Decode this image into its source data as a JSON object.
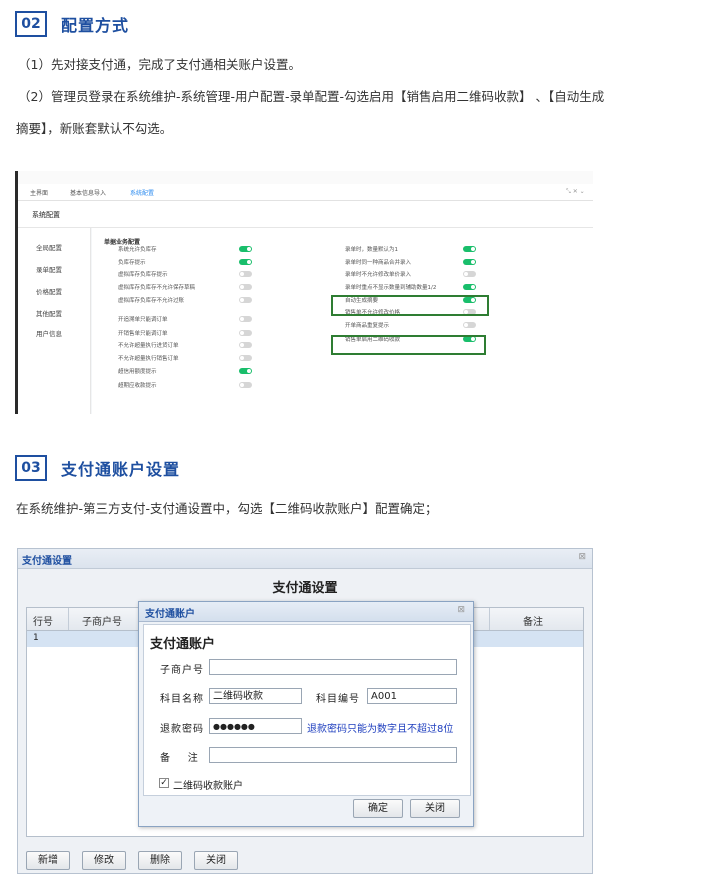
{
  "section2": {
    "number": "02",
    "title": "配置方式",
    "para1": "（1）先对接支付通，完成了支付通相关账户设置。",
    "para2a": "（2）管理员登录在系统维护-系统管理-用户配置-录单配置-勾选启用【销售启用二维码收款】 、【自动生成",
    "para2b": "摘要】，新账套默认不勾选。"
  },
  "shot1": {
    "tabs": [
      "主界面",
      "基本信息导入",
      "系统配置"
    ],
    "page_title": "系统配置",
    "sidebar": [
      "全局配置",
      "录单配置",
      "价格配置",
      "其他配置",
      "用户信息"
    ],
    "group_title": "单据业务配置",
    "left_options": [
      {
        "label": "系统允许负库存",
        "on": true
      },
      {
        "label": "负库存提示",
        "on": true
      },
      {
        "label": "虚拟库存负库存提示",
        "on": false
      },
      {
        "label": "虚拟库存负库存不允许保存草稿",
        "on": false
      },
      {
        "label": "虚拟库存负库存不允许过账",
        "on": false
      },
      {
        "label": "开追溯单只能调订单",
        "on": false
      },
      {
        "label": "开销售单只能调订单",
        "on": false
      },
      {
        "label": "不允许超量执行进货订单",
        "on": false
      },
      {
        "label": "不允许超量执行销售订单",
        "on": false
      },
      {
        "label": "超信用额度提示",
        "on": true
      },
      {
        "label": "超期应收款提示",
        "on": false
      }
    ],
    "right_options": [
      {
        "label": "录单时，数量默认为1",
        "on": true
      },
      {
        "label": "录单时同一种商品合并录入",
        "on": true
      },
      {
        "label": "录单时不允许修改单价录入",
        "on": false
      },
      {
        "label": "录单时重点不显示数量到辅助数量1/2",
        "on": true
      },
      {
        "label": "自动生成摘要",
        "on": true
      },
      {
        "label": "销售单不允许修改价格",
        "on": false
      },
      {
        "label": "开单商品重复提示",
        "on": false
      },
      {
        "label": "销售单启用二维码收款",
        "on": true
      }
    ]
  },
  "section3": {
    "number": "03",
    "title": "支付通账户设置",
    "para": "在系统维护-第三方支付-支付通设置中，勾选【二维码收款账户】配置确定；"
  },
  "shot2": {
    "window_title": "支付通设置",
    "heading": "支付通设置",
    "columns": [
      "行号",
      "子商户号",
      "备注"
    ],
    "rows": [
      {
        "row_no": "1"
      }
    ],
    "buttons": {
      "add": "新增",
      "edit": "修改",
      "delete": "删除",
      "close": "关闭"
    },
    "dialog": {
      "title": "支付通账户",
      "heading": "支付通账户",
      "sub_merchant_label": "子商户号",
      "sub_merchant_value": "",
      "subject_name_label": "科目名称",
      "subject_name_value": "二维码收款",
      "subject_code_label": "科目编号",
      "subject_code_value": "A001",
      "refund_pwd_label": "退款密码",
      "refund_pwd_value": "●●●●●●",
      "refund_pwd_hint": "退款密码只能为数字且不超过8位",
      "remark_label": "备    注",
      "remark_value": "",
      "qr_checkbox_label": "二维码收款账户",
      "qr_checked": true,
      "ok": "确定",
      "close": "关闭"
    }
  }
}
